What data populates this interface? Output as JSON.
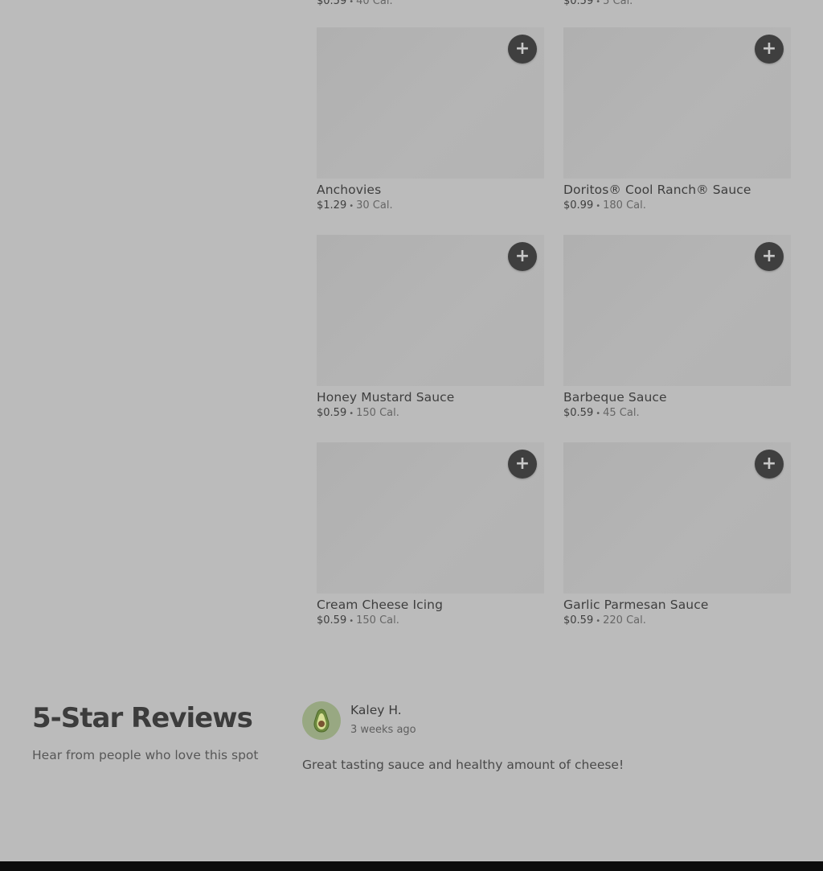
{
  "top_items": [
    {
      "price": "$0.59",
      "calories": "40 Cal."
    },
    {
      "price": "$0.59",
      "calories": "5 Cal."
    }
  ],
  "items": [
    {
      "name": "Anchovies",
      "price": "$1.29",
      "calories": "30 Cal."
    },
    {
      "name": "Doritos® Cool Ranch® Sauce",
      "price": "$0.99",
      "calories": "180 Cal."
    },
    {
      "name": "Honey Mustard Sauce",
      "price": "$0.59",
      "calories": "150 Cal."
    },
    {
      "name": "Barbeque Sauce",
      "price": "$0.59",
      "calories": "45 Cal."
    },
    {
      "name": "Cream Cheese Icing",
      "price": "$0.59",
      "calories": "150 Cal."
    },
    {
      "name": "Garlic Parmesan Sauce",
      "price": "$0.59",
      "calories": "220 Cal."
    }
  ],
  "separator": "•",
  "add_button": {
    "glyph": "+",
    "icon": "plus-icon"
  },
  "reviews": {
    "title": "5-Star Reviews",
    "subtitle": "Hear from people who love this spot",
    "list": [
      {
        "reviewer": "Kaley H.",
        "date": "3 weeks ago",
        "text": "Great tasting sauce and healthy amount of cheese!",
        "avatar_icon": "avocado-icon"
      }
    ]
  },
  "colors": {
    "page_bg": "#bbbbbb",
    "button_bg": "#3f3f3f",
    "avatar_bg": "#98a882",
    "footer": "#0c0c0c"
  }
}
